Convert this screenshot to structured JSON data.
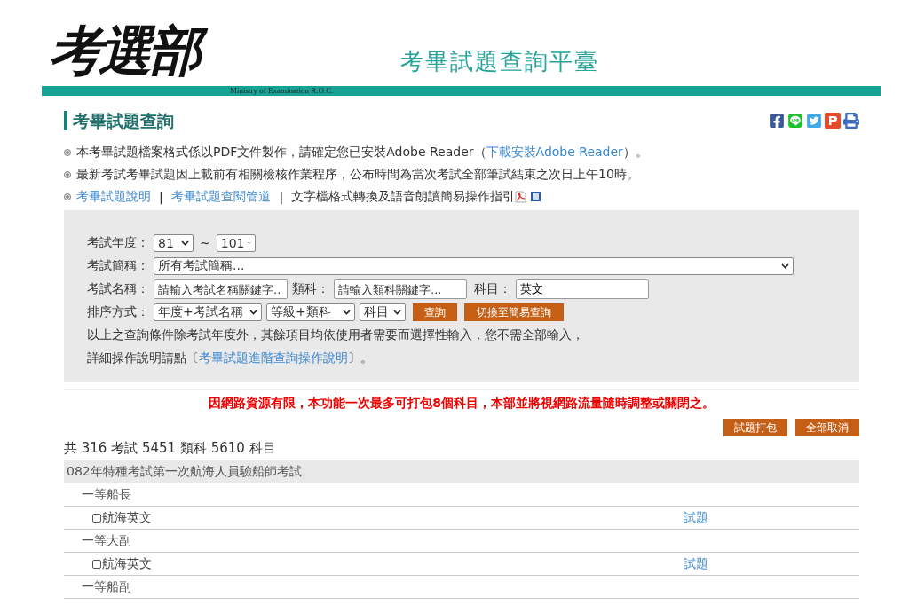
{
  "header": {
    "logo": "考選部",
    "logo_subtitle": "Ministry of Examination R.O.C.",
    "site_title": "考畢試題查詢平臺"
  },
  "page_title": "考畢試題查詢",
  "notices": [
    {
      "parts": [
        {
          "text": "本考畢試題檔案格式係以PDF文件製作，請確定您已安裝Adobe Reader（",
          "kind": "text"
        },
        {
          "text": "下載安裝Adobe Reader",
          "kind": "link"
        },
        {
          "text": "）。",
          "kind": "text"
        }
      ]
    },
    {
      "parts": [
        {
          "text": "最新考試考畢試題因上載前有相關檢核作業程序，公布時間為當次考試全部筆試結束之次日上午10時。",
          "kind": "text"
        }
      ]
    },
    {
      "parts": [
        {
          "text": "考畢試題說明",
          "kind": "link"
        },
        {
          "text": "|",
          "kind": "sep"
        },
        {
          "text": "考畢試題查閱管道",
          "kind": "link"
        },
        {
          "text": "|",
          "kind": "sep"
        },
        {
          "text": "文字檔格式轉換及語音朗讀簡易操作指引",
          "kind": "text"
        },
        {
          "kind": "pdf_icon"
        },
        {
          "kind": "doc_icon"
        }
      ]
    }
  ],
  "form": {
    "year_label": "考試年度：",
    "year_from": "81",
    "year_sep": "~",
    "year_to": "101",
    "abbr_label": "考試簡稱：",
    "abbr_value": "所有考試簡稱...",
    "name_label": "考試名稱：",
    "name_placeholder": "請輸入考試名稱關鍵字..",
    "category_label": "類科：",
    "category_placeholder": "請輸入類科關鍵字...",
    "subject_label": "科目：",
    "subject_value": "英文",
    "sort_label": "排序方式：",
    "sort_options": [
      "年度+考試名稱",
      "等級+類科",
      "科目"
    ],
    "buttons": [
      "查詢",
      "切換至簡易查詢"
    ],
    "hint": "以上之查詢條件除考試年度外，其餘項目均依使用者需要而選擇性輸入，您不需全部輸入，",
    "detail_prefix": "詳細操作說明請點〔",
    "detail_link": "考畢試題進階查詢操作說明",
    "detail_suffix": "〕。"
  },
  "warning": "因網路資源有限，本功能一次最多可打包8個科目，本部並將視網路流量隨時調整或關閉之。",
  "actions": [
    "試題打包",
    "全部取消"
  ],
  "summary": "共 316 考試 5451 類科 5610 科目",
  "results": [
    {
      "title": "082年特種考試第一次航海人員驗船師考試",
      "children": [
        {
          "title": "一等船長",
          "children": [
            {
              "title": "航海英文",
              "checked": false,
              "link": "試題"
            }
          ]
        },
        {
          "title": "一等大副",
          "children": [
            {
              "title": "航海英文",
              "checked": false,
              "link": "試題"
            }
          ]
        },
        {
          "title": "一等船副"
        }
      ]
    }
  ]
}
